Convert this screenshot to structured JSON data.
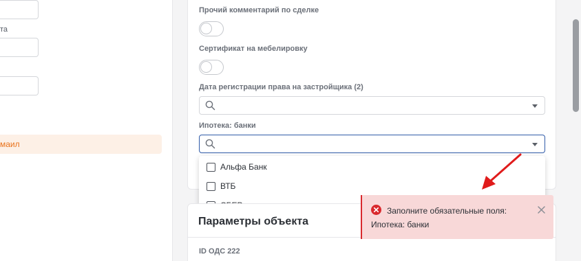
{
  "left_panel": {
    "label_1": "та",
    "active_item": "маил"
  },
  "form": {
    "fields": [
      {
        "label": "Прочий комментарий по сделке",
        "type": "toggle",
        "value": false
      },
      {
        "label": "Сертификат на мебелировку",
        "type": "toggle",
        "value": false
      },
      {
        "label": "Дата регистрации права на застройщика (2)",
        "type": "select",
        "value": ""
      },
      {
        "label": "Ипотека: банки",
        "type": "select",
        "value": "",
        "focused": true
      }
    ]
  },
  "dropdown": {
    "options": [
      {
        "label": "Альфа Банк",
        "checked": false
      },
      {
        "label": "ВТБ",
        "checked": false
      },
      {
        "label": "СБЕР",
        "checked": false
      }
    ]
  },
  "section": {
    "title": "Параметры объекта",
    "first_field_label": "ID ОДС 222"
  },
  "toast": {
    "type": "error",
    "message": "Заполните обязательные поля:",
    "field": "Ипотека: банки",
    "icon": "error-circle-icon",
    "color": "#d9292d"
  },
  "colors": {
    "accent": "#e8711a",
    "focus": "#2f5aa8",
    "arrow": "#e01b1b"
  }
}
